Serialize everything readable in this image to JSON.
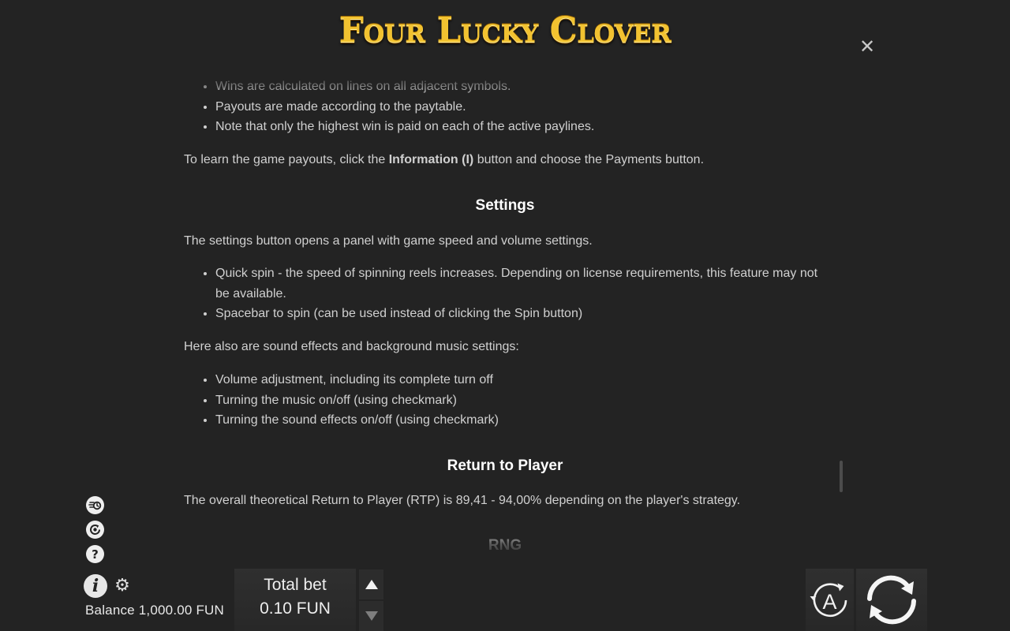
{
  "game": {
    "title": "Four Lucky Clover"
  },
  "rules": {
    "wins_bullets": [
      "Wins are calculated on lines on all adjacent symbols.",
      "Payouts are made according to the paytable.",
      "Note that only the highest win is paid on each of the active paylines."
    ],
    "payouts_pre": "To learn the game payouts, click the ",
    "payouts_bold": "Information (I)",
    "payouts_post": " button and choose the Payments button.",
    "settings_heading": "Settings",
    "settings_intro": "The settings button opens a panel with game speed and volume settings.",
    "settings_bullets": [
      "Quick spin - the speed of spinning reels increases. Depending on license requirements, this feature may not be available.",
      "Spacebar to spin (can be used instead of clicking the Spin button)"
    ],
    "sound_intro": "Here also are sound effects and background music settings:",
    "sound_bullets": [
      "Volume adjustment, including its complete turn off",
      "Turning the music on/off (using checkmark)",
      "Turning the sound effects on/off (using checkmark)"
    ],
    "rtp_heading": "Return to Player",
    "rtp_text": "The overall theoretical Return to Player (RTP) is 89,41 - 94,00% depending on the player's strategy.",
    "rng_heading": "RNG"
  },
  "footer": {
    "balance_label": "Balance",
    "balance_value": "1,000.00 FUN",
    "total_bet_label": "Total bet",
    "total_bet_value": "0.10 FUN",
    "auto_label": "A"
  },
  "icons": {
    "close": "close-icon",
    "fast_play": "fast-play-icon",
    "history": "history-icon",
    "help": "help-icon",
    "info": "info-icon",
    "settings": "gear-icon",
    "bet_up": "arrow-up-icon",
    "bet_down": "arrow-down-icon",
    "autoplay": "autoplay-icon",
    "spin": "spin-icon"
  },
  "colors": {
    "background": "#232323",
    "logo_gold": "#f2c230",
    "heading": "#ffffff",
    "body_text": "#d0d0d0"
  }
}
